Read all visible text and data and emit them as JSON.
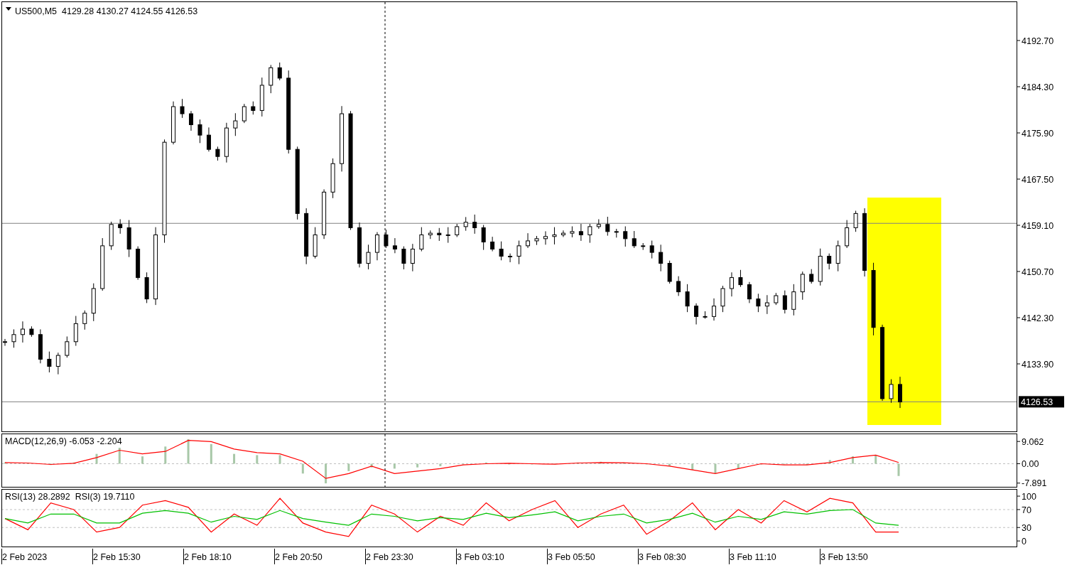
{
  "main_chart": {
    "header": "US500,M5  4129.28 4130.27 4124.55 4126.53",
    "price_label": "4126.53",
    "price_axis": [
      "4192.70",
      "4184.30",
      "4175.90",
      "4167.50",
      "4159.10",
      "4150.70",
      "4142.30",
      "4133.90"
    ]
  },
  "macd_panel": {
    "title": "MACD(12,26,9) -6.053 -2.204",
    "axis": [
      "9.062",
      "0.00",
      "-7.891"
    ]
  },
  "rsi_panel": {
    "title": "RSI(13) 28.2892  RSI(3) 19.7110",
    "axis": [
      "100",
      "70",
      "30",
      "0"
    ]
  },
  "time_axis": [
    "2 Feb 2023",
    "2 Feb 15:30",
    "2 Feb 18:10",
    "2 Feb 20:50",
    "2 Feb 23:30",
    "3 Feb 03:10",
    "3 Feb 05:50",
    "3 Feb 08:30",
    "3 Feb 11:10",
    "3 Feb 13:50"
  ]
}
